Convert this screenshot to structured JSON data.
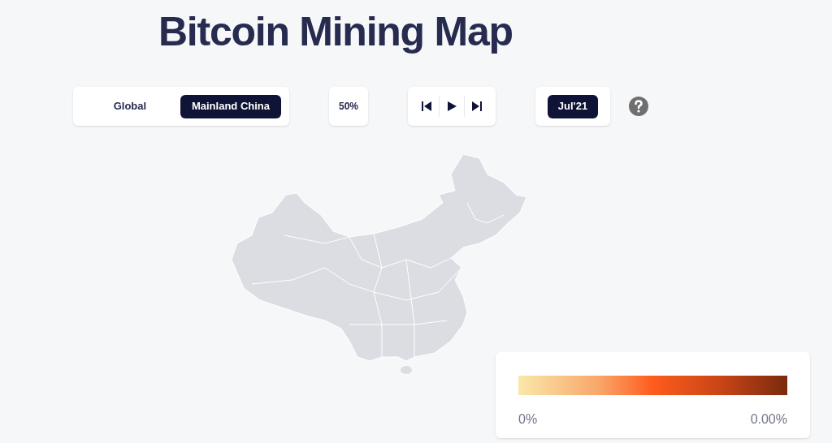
{
  "title": "Bitcoin Mining Map",
  "scope_tabs": [
    {
      "label": "Global",
      "selected": false
    },
    {
      "label": "Mainland China",
      "selected": true
    }
  ],
  "zoom": "50%",
  "date": "Jul'21",
  "legend": {
    "min_label": "0%",
    "max_label": "0.00%"
  }
}
